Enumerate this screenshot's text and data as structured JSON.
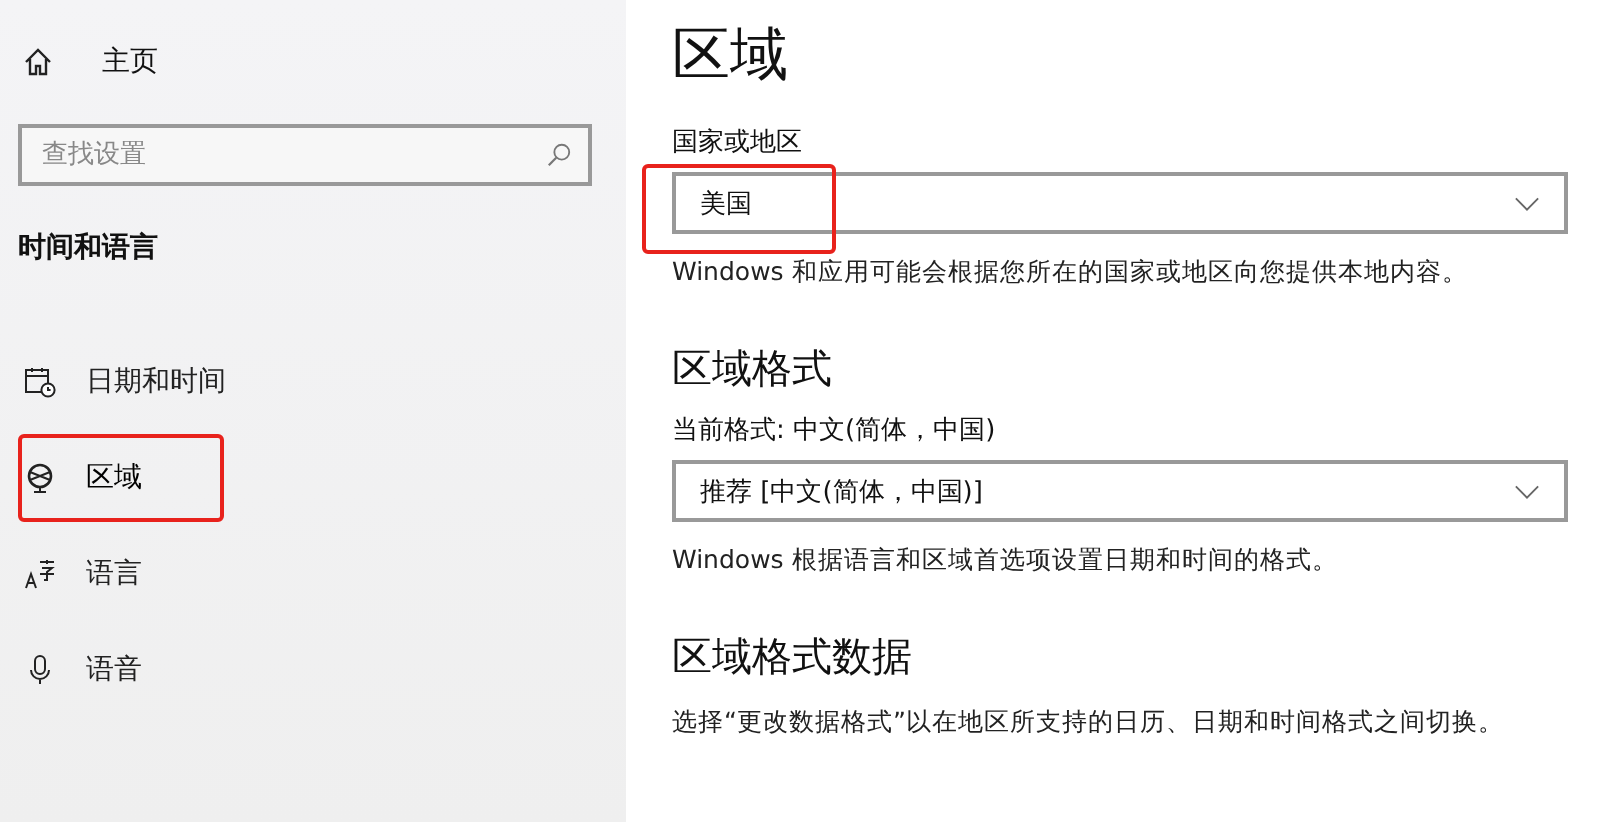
{
  "sidebar": {
    "home": "主页",
    "search": {
      "placeholder": "查找设置"
    },
    "section_title": "时间和语言",
    "items": [
      {
        "label": "日期和时间",
        "kind": "calendar",
        "selected": false,
        "annotated": false
      },
      {
        "label": "区域",
        "kind": "globe",
        "selected": true,
        "annotated": true
      },
      {
        "label": "语言",
        "kind": "language",
        "selected": false,
        "annotated": false
      },
      {
        "label": "语音",
        "kind": "mic",
        "selected": false,
        "annotated": false
      }
    ]
  },
  "main": {
    "title": "区域",
    "country": {
      "label": "国家或地区",
      "value": "美国",
      "annotated": true,
      "description": "Windows 和应用可能会根据您所在的国家或地区向您提供本地内容。"
    },
    "format": {
      "heading": "区域格式",
      "label": "当前格式: 中文(简体，中国)",
      "value": "推荐 [中文(简体，中国)]",
      "description": "Windows 根据语言和区域首选项设置日期和时间的格式。"
    },
    "format_data": {
      "heading": "区域格式数据",
      "description": "选择“更改数据格式”以在地区所支持的日历、日期和时间格式之间切换。"
    }
  }
}
